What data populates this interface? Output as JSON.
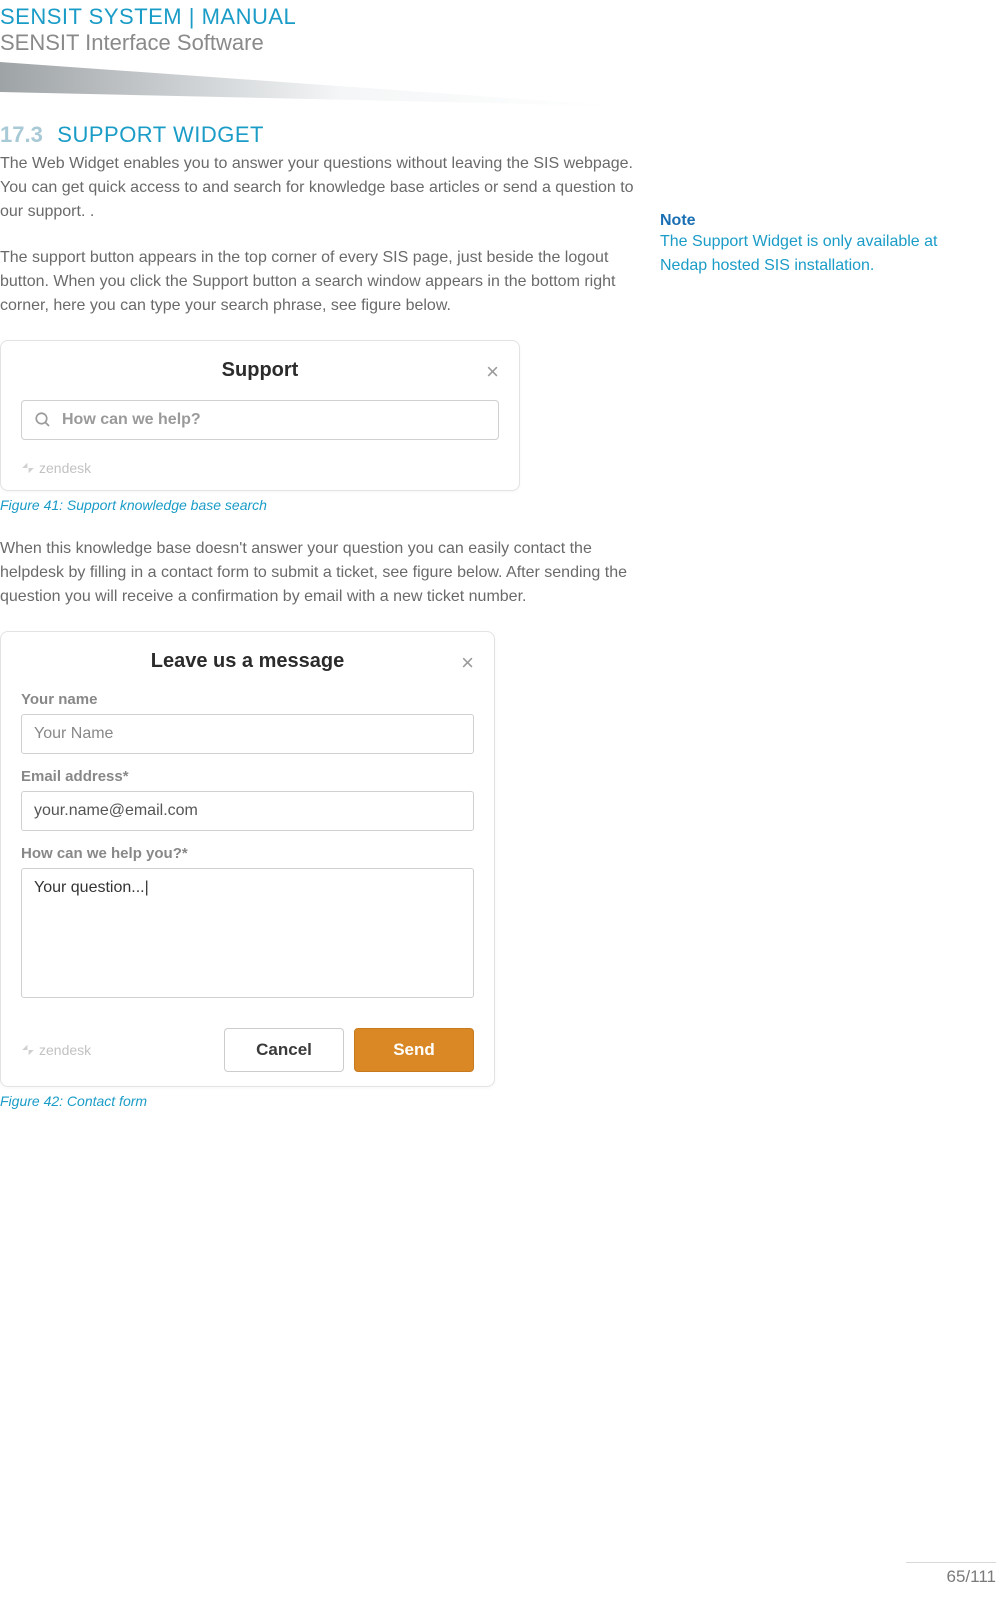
{
  "header": {
    "title": "SENSIT SYSTEM | MANUAL",
    "subtitle": "SENSIT Interface Software"
  },
  "section": {
    "number": "17.3",
    "title": "SUPPORT WIDGET",
    "para1": "The Web Widget enables you to answer your questions without leaving the SIS webpage. You can get quick access to and search for knowledge base articles or send a question to our support. .",
    "para2": "The support button appears in the top corner of every SIS page, just beside the logout button. When you click the Support button a search window appears in the bottom right corner, here you can type your search phrase, see figure below.",
    "para3": "When this knowledge base doesn't answer your question you can easily contact the helpdesk by filling in a contact form to submit a ticket, see figure below. After sending the question you will receive a confirmation by email with a new ticket number."
  },
  "note": {
    "title": "Note",
    "body": "The Support Widget is only available at Nedap hosted SIS installation."
  },
  "figure1": {
    "title": "Support",
    "placeholder": "How can we help?",
    "brand": "zendesk",
    "caption": "Figure 41: Support knowledge base search"
  },
  "figure2": {
    "title": "Leave us a message",
    "name_label": "Your name",
    "name_value": "Your Name",
    "email_label": "Email address*",
    "email_value": "your.name@email.com",
    "help_label": "How can we help you?*",
    "help_value": "Your question...|",
    "cancel": "Cancel",
    "send": "Send",
    "brand": "zendesk",
    "caption": "Figure 42: Contact form"
  },
  "page_number": "65/111"
}
